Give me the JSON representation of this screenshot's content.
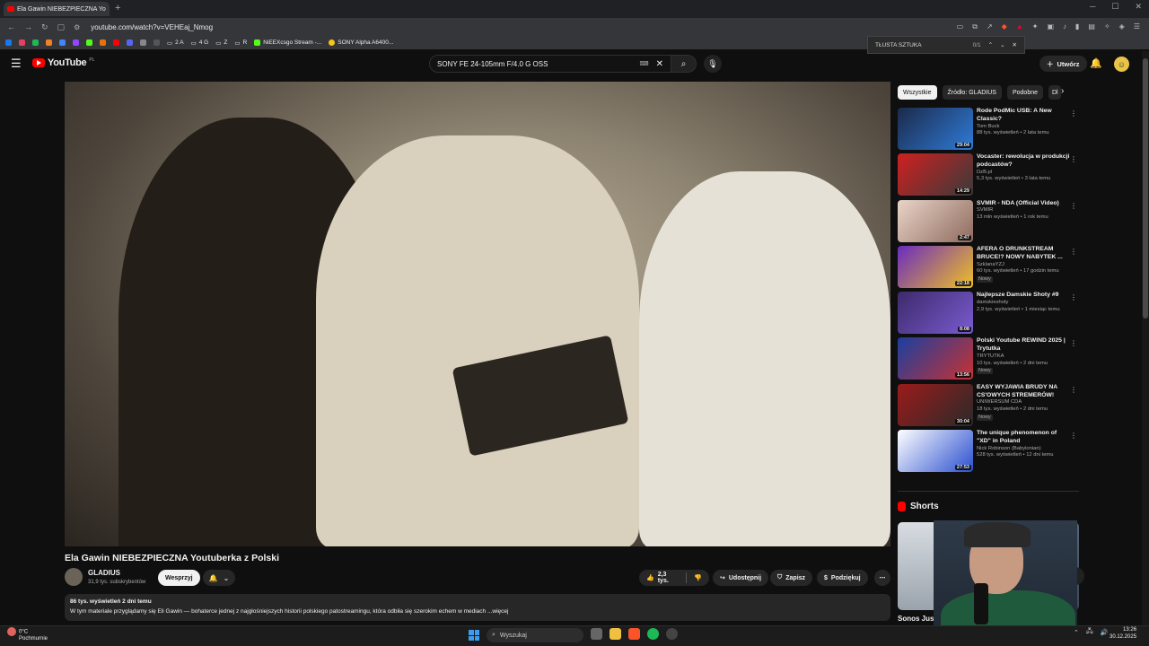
{
  "browser": {
    "tab_title": "Ela Gawin NIEBEZPIECZNA Yo",
    "new_tab": "+",
    "url": "youtube.com/watch?v=VEHEaj_Nmog",
    "bookmarks": [
      "2 A",
      "4 G",
      "Z",
      "R",
      "NiEEXcsgo Stream -...",
      "SONY Alpha A6400..."
    ]
  },
  "findbar": {
    "query": "TŁUSTA SZTUKA",
    "count": "0/1"
  },
  "yt": {
    "logo": "YouTube",
    "country": "PL",
    "search_value": "SONY FE 24-105mm F/4.0 G OSS",
    "create_label": "Utwórz"
  },
  "video": {
    "title": "Ela Gawin NIEBEZPIECZNA Youtuberka z Polski",
    "channel": "GLADIUS",
    "subs": "31,9 tys. subskrybentów",
    "support_label": "Wesprzyj",
    "likes": "2,3 tys.",
    "share_label": "Udostępnij",
    "save_label": "Zapisz",
    "thanks_label": "Podziękuj",
    "views_date": "86 tys. wyświetleń  2 dni temu",
    "description": "W tym materiale przyglądamy się Eli Gawin — bohaterce jednej z najgłośniejszych historii polskiego patostreamingu, która odbiła się szerokim echem w mediach ...więcej"
  },
  "chips": [
    "Wszystkie",
    "Źródło: GLADIUS",
    "Podobne",
    "Dl"
  ],
  "recs": [
    {
      "title": "Rode PodMic USB: A New Classic?",
      "channel": "Tom Buck",
      "stats": "88 tys. wyświetleń • 2 lata temu",
      "dur": "29:04",
      "new": "",
      "c1": "#1b2a4a",
      "c2": "#2f7bd8"
    },
    {
      "title": "Vocaster: rewolucja w produkcji podcastów?",
      "channel": "DzB.pl",
      "stats": "5,3 tys. wyświetleń • 3 lata temu",
      "dur": "14:29",
      "new": "",
      "c1": "#cf2020",
      "c2": "#3a3a3a"
    },
    {
      "title": "SVMIR - NDA (Official Video)",
      "channel": "SVMIR",
      "stats": "13 mln wyświetleń • 1 rok temu",
      "dur": "2:47",
      "new": "",
      "c1": "#e9d4c8",
      "c2": "#8e6b5e"
    },
    {
      "title": "AFERA O DRUNKSTREAM BRUCE!? NOWY NABYTEK ...",
      "channel": "SzklanaYZJ",
      "stats": "60 tys. wyświetleń • 17 godzin temu",
      "dur": "22:18",
      "new": "Nowy",
      "c1": "#6a2bbf",
      "c2": "#f0c026"
    },
    {
      "title": "Najlepsze Damskie Shoty #9",
      "channel": "damskieshoty",
      "stats": "2,9 tys. wyświetleń • 1 miesiąc temu",
      "dur": "8:08",
      "new": "",
      "c1": "#3d2a6b",
      "c2": "#7a5bd0"
    },
    {
      "title": "Polski Youtube REWIND 2025 | Trytutka",
      "channel": "TRYTUTKA",
      "stats": "10 tys. wyświetleń • 2 dni temu",
      "dur": "13:56",
      "new": "Nowy",
      "c1": "#1a3fa0",
      "c2": "#c83232"
    },
    {
      "title": "EASY WYJAWIA BRUDY NA CS'OWYCH STREMERÓW!",
      "channel": "UNIWERSUM CDA",
      "stats": "18 tys. wyświetleń • 2 dni temu",
      "dur": "30:04",
      "new": "Nowy",
      "c1": "#9c1b1b",
      "c2": "#2a2a2a"
    },
    {
      "title": "The unique phenomenon of \"XD\" in Poland",
      "channel": "Nick Robinson (Babylonian)",
      "stats": "528 tys. wyświetleń • 12 dni temu",
      "dur": "27:53",
      "new": "",
      "c1": "#ffffff",
      "c2": "#2a4fcf"
    }
  ],
  "shorts": {
    "heading": "Shorts",
    "first_label": "Sonos Just"
  },
  "taskbar": {
    "temp": "0°C",
    "weather": "Pochmurnie",
    "search": "Wyszukaj",
    "time": "13:26",
    "date": "30.12.2025"
  }
}
